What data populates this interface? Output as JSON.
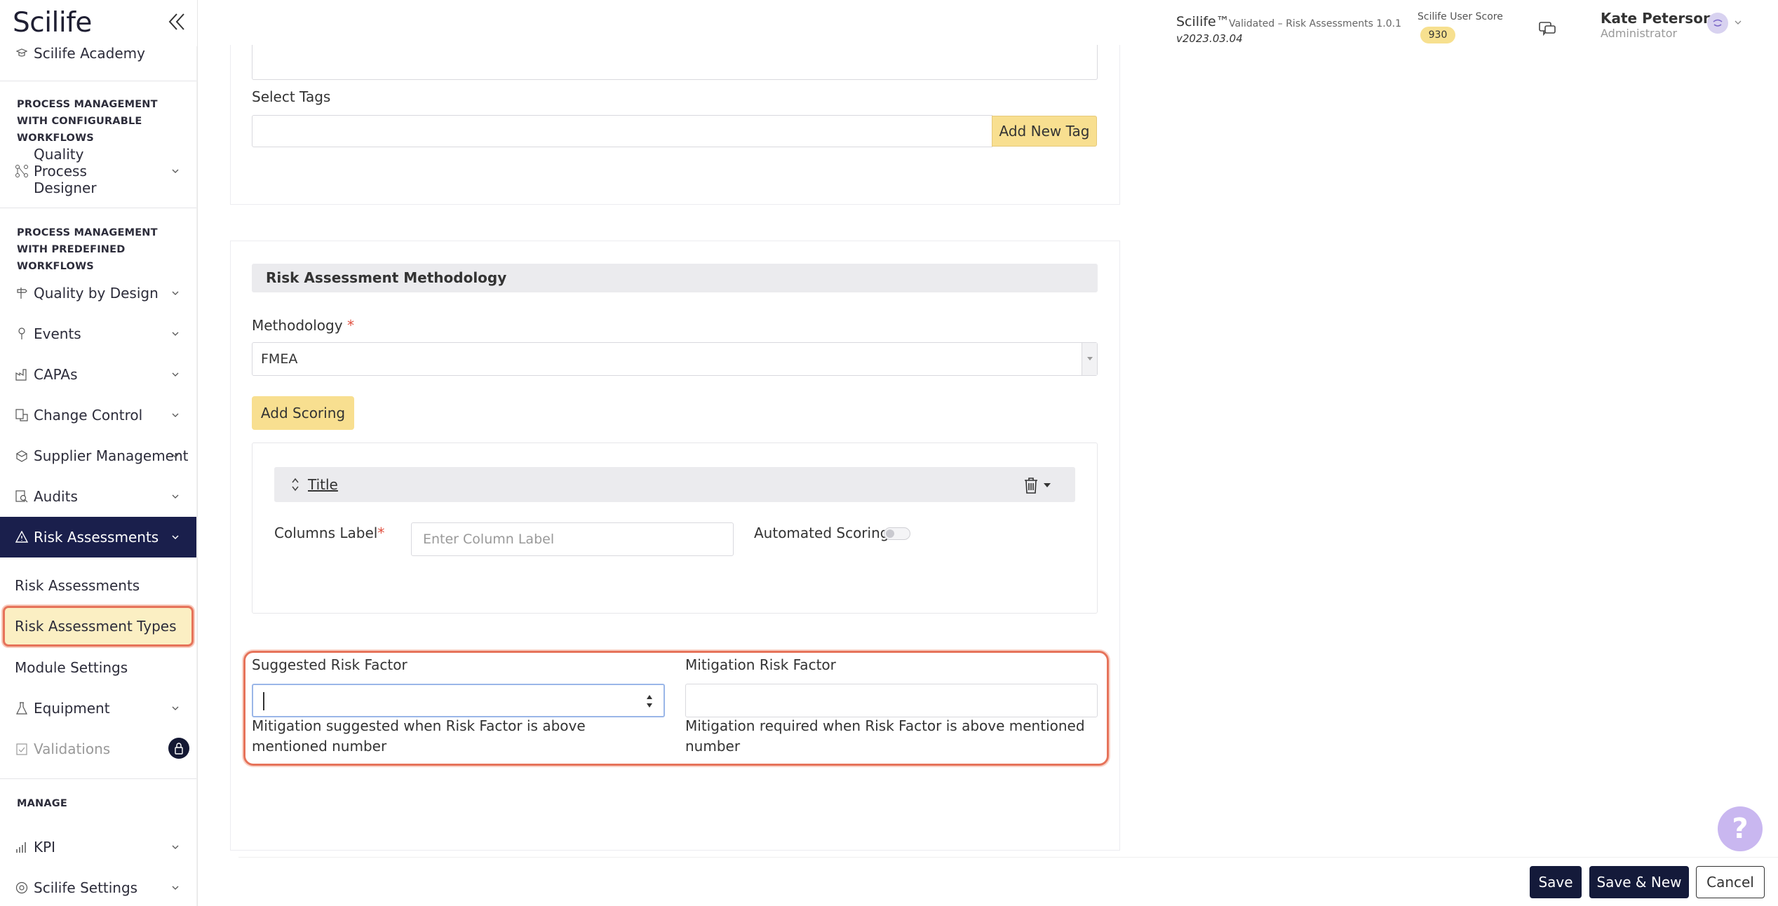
{
  "app": {
    "logo": "Scilife",
    "name": "Scilife™",
    "validated": "Validated – Risk Assessments 1.0.1",
    "version": "v2023.03.04"
  },
  "header": {
    "score_label": "Scilife User Score",
    "score_value": "930",
    "user_name": "Kate Peterson",
    "user_role": "Administrator"
  },
  "sidebar": {
    "top_item": "Scilife Academy",
    "section_configurable": "PROCESS MANAGEMENT WITH CONFIGURABLE WORKFLOWS",
    "quality_process_designer": "Quality Process Designer",
    "section_predefined": "PROCESS MANAGEMENT WITH PREDEFINED WORKFLOWS",
    "items": [
      "Quality by Design",
      "Events",
      "CAPAs",
      "Change Control",
      "Supplier Management",
      "Audits"
    ],
    "active_item": "Risk Assessments",
    "sub_items": [
      "Risk Assessments",
      "Risk Assessment Types",
      "Module Settings"
    ],
    "equipment": "Equipment",
    "validations": "Validations",
    "section_manage": "MANAGE",
    "kpi": "KPI",
    "settings": "Scilife Settings"
  },
  "form": {
    "select_tags_label": "Select Tags",
    "add_tag_button": "Add New Tag",
    "methodology_section": "Risk Assessment Methodology",
    "methodology_label": "Methodology",
    "required_mark": "*",
    "methodology_value": "FMEA",
    "add_scoring_button": "Add Scoring",
    "scoring_title": "Title",
    "columns_label": "Columns Label",
    "columns_placeholder": "Enter Column Label",
    "automated_scoring": "Automated Scoring",
    "suggested_label": "Suggested Risk Factor",
    "suggested_hint": "Mitigation suggested when Risk Factor is above mentioned number",
    "mitigation_label": "Mitigation Risk Factor",
    "mitigation_hint": "Mitigation required when Risk Factor is above mentioned number"
  },
  "footer": {
    "save": "Save",
    "save_new": "Save & New",
    "cancel": "Cancel"
  },
  "colors": {
    "navy": "#141a3a",
    "yellow": "#f8df90",
    "highlight": "#e6735a"
  }
}
